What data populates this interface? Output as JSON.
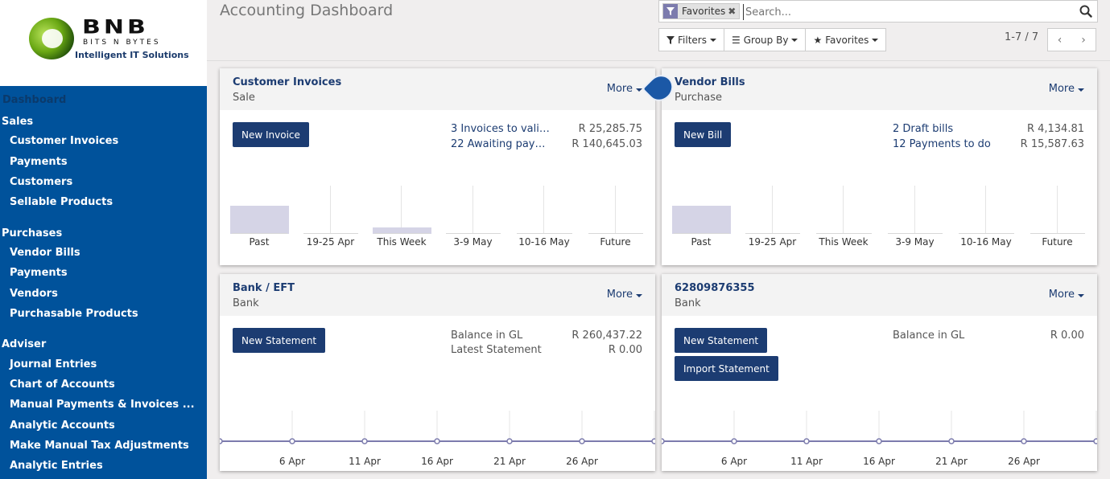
{
  "logo": {
    "brand": "BNB",
    "subline": "BITS N BYTES",
    "tagline": "Intelligent IT Solutions"
  },
  "sidebar": {
    "dashboard": "Dashboard",
    "sections": [
      {
        "label": "Sales",
        "items": [
          "Customer Invoices",
          "Payments",
          "Customers",
          "Sellable Products"
        ]
      },
      {
        "label": "Purchases",
        "items": [
          "Vendor Bills",
          "Payments",
          "Vendors",
          "Purchasable Products"
        ]
      },
      {
        "label": "Adviser",
        "items": [
          "Journal Entries",
          "Chart of Accounts",
          "Manual Payments & Invoices ...",
          "Analytic Accounts",
          "Make Manual Tax Adjustments",
          "Analytic Entries"
        ]
      }
    ]
  },
  "header": {
    "title": "Accounting Dashboard"
  },
  "search": {
    "facet": "Favorites",
    "placeholder": "Search..."
  },
  "buttons": {
    "filters": "Filters",
    "group_by": "Group By",
    "favorites": "Favorites"
  },
  "pager": {
    "text": "1-7 / 7"
  },
  "cards": {
    "customer_invoices": {
      "title": "Customer Invoices",
      "subtitle": "Sale",
      "more": "More",
      "button": "New Invoice",
      "lines": [
        {
          "label": "3 Invoices to vali…",
          "amount": "R 25,285.75"
        },
        {
          "label": "22 Awaiting pay…",
          "amount": "R 140,645.03"
        }
      ],
      "bars": [
        {
          "label": "Past",
          "value": 1.0
        },
        {
          "label": "19-25 Apr",
          "value": 0.0
        },
        {
          "label": "This Week",
          "value": 0.22
        },
        {
          "label": "3-9 May",
          "value": 0.0
        },
        {
          "label": "10-16 May",
          "value": 0.0
        },
        {
          "label": "Future",
          "value": 0.0
        }
      ]
    },
    "vendor_bills": {
      "title": "Vendor Bills",
      "subtitle": "Purchase",
      "more": "More",
      "button": "New Bill",
      "lines": [
        {
          "label": "2 Draft bills",
          "amount": "R 4,134.81"
        },
        {
          "label": "12 Payments to do",
          "amount": "R 15,587.63"
        }
      ],
      "bars": [
        {
          "label": "Past",
          "value": 1.0
        },
        {
          "label": "19-25 Apr",
          "value": 0.0
        },
        {
          "label": "This Week",
          "value": 0.0
        },
        {
          "label": "3-9 May",
          "value": 0.0
        },
        {
          "label": "10-16 May",
          "value": 0.0
        },
        {
          "label": "Future",
          "value": 0.0
        }
      ]
    },
    "bank_eft": {
      "title": "Bank / EFT",
      "subtitle": "Bank",
      "more": "More",
      "button": "New Statement",
      "lines": [
        {
          "label": "Balance in GL",
          "amount": "R 260,437.22"
        },
        {
          "label": "Latest Statement",
          "amount": "R 0.00"
        }
      ],
      "ticks": [
        "6 Apr",
        "11 Apr",
        "16 Apr",
        "21 Apr",
        "26 Apr"
      ]
    },
    "bank_account": {
      "title": "62809876355",
      "subtitle": "Bank",
      "more": "More",
      "button": "New Statement",
      "button2": "Import Statement",
      "lines": [
        {
          "label": "Balance in GL",
          "amount": "R 0.00"
        }
      ],
      "ticks": [
        "6 Apr",
        "11 Apr",
        "16 Apr",
        "21 Apr",
        "26 Apr"
      ]
    }
  },
  "colors": {
    "primary": "#1c3c72",
    "sidebar": "#00529b",
    "bar": "#d5d4e6",
    "line": "#7c7bad"
  },
  "icons": {
    "search": "search-icon",
    "filter": "filter-icon",
    "star": "star-icon"
  }
}
